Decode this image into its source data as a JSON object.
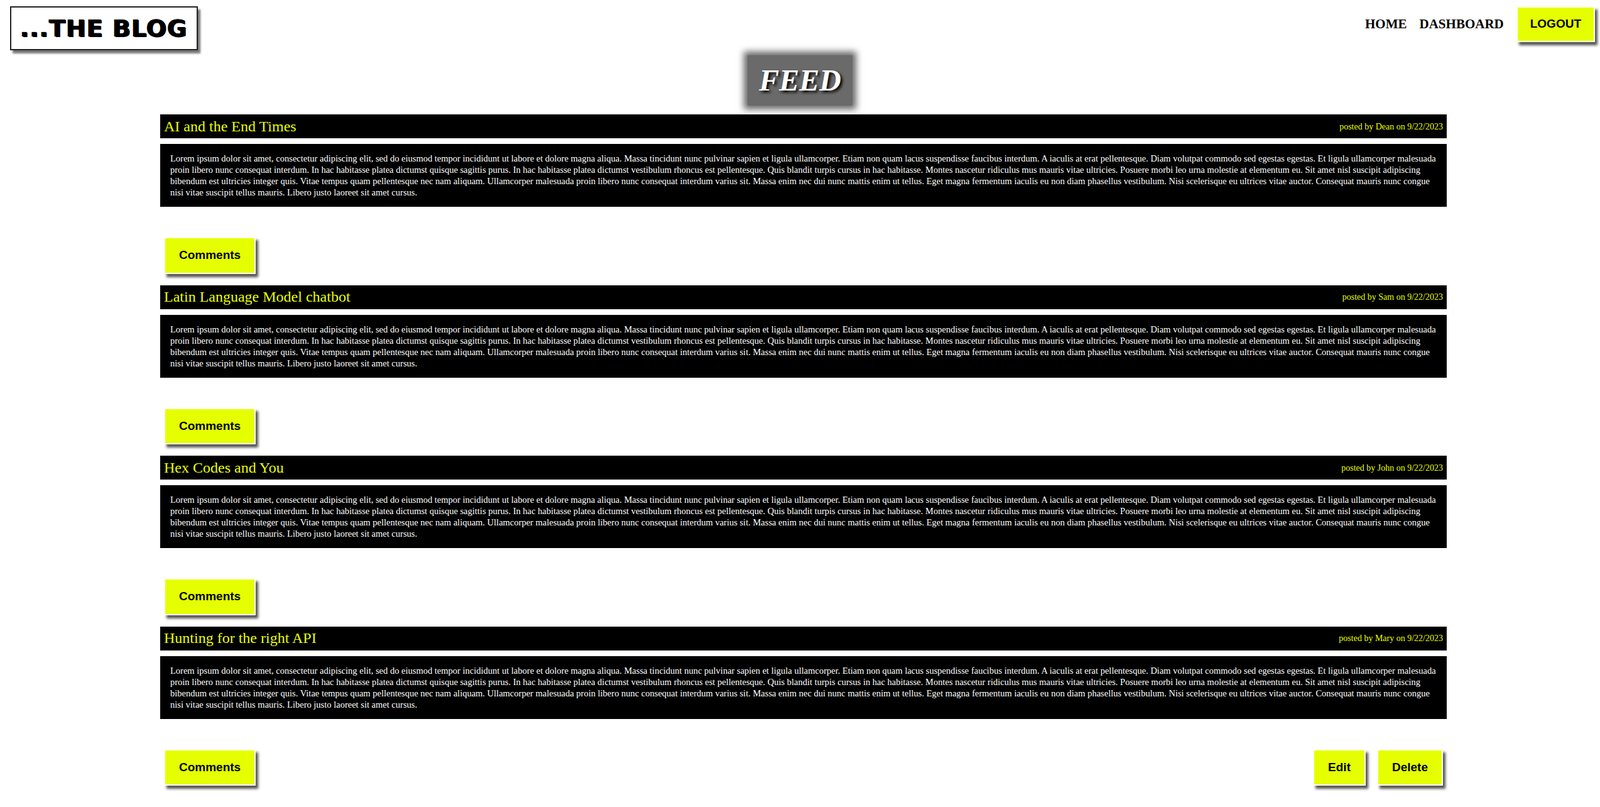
{
  "logo": "...THE BLOG",
  "nav": {
    "links": [
      "HOME",
      "DASHBOARD"
    ],
    "logout": "LOGOUT"
  },
  "page_title": "FEED",
  "posts": [
    {
      "title": "AI and the End Times",
      "meta": "posted by Dean on 9/22/2023",
      "body": "Lorem ipsum dolor sit amet, consectetur adipiscing elit, sed do eiusmod tempor incididunt ut labore et dolore magna aliqua. Massa tincidunt nunc pulvinar sapien et ligula ullamcorper. Etiam non quam lacus suspendisse faucibus interdum. A iaculis at erat pellentesque. Diam volutpat commodo sed egestas egestas. Et ligula ullamcorper malesuada proin libero nunc consequat interdum. In hac habitasse platea dictumst quisque sagittis purus. In hac habitasse platea dictumst vestibulum rhoncus est pellentesque. Quis blandit turpis cursus in hac habitasse. Montes nascetur ridiculus mus mauris vitae ultricies. Posuere morbi leo urna molestie at elementum eu. Sit amet nisl suscipit adipiscing bibendum est ultricies integer quis. Vitae tempus quam pellentesque nec nam aliquam. Ullamcorper malesuada proin libero nunc consequat interdum varius sit. Massa enim nec dui nunc mattis enim ut tellus. Eget magna fermentum iaculis eu non diam phasellus vestibulum. Nisi scelerisque eu ultrices vitae auctor. Consequat mauris nunc congue nisi vitae suscipit tellus mauris. Libero justo laoreet sit amet cursus.",
      "comments": "Comments",
      "actions": []
    },
    {
      "title": "Latin Language Model chatbot",
      "meta": "posted by Sam on 9/22/2023",
      "body": "Lorem ipsum dolor sit amet, consectetur adipiscing elit, sed do eiusmod tempor incididunt ut labore et dolore magna aliqua. Massa tincidunt nunc pulvinar sapien et ligula ullamcorper. Etiam non quam lacus suspendisse faucibus interdum. A iaculis at erat pellentesque. Diam volutpat commodo sed egestas egestas. Et ligula ullamcorper malesuada proin libero nunc consequat interdum. In hac habitasse platea dictumst quisque sagittis purus. In hac habitasse platea dictumst vestibulum rhoncus est pellentesque. Quis blandit turpis cursus in hac habitasse. Montes nascetur ridiculus mus mauris vitae ultricies. Posuere morbi leo urna molestie at elementum eu. Sit amet nisl suscipit adipiscing bibendum est ultricies integer quis. Vitae tempus quam pellentesque nec nam aliquam. Ullamcorper malesuada proin libero nunc consequat interdum varius sit. Massa enim nec dui nunc mattis enim ut tellus. Eget magna fermentum iaculis eu non diam phasellus vestibulum. Nisi scelerisque eu ultrices vitae auctor. Consequat mauris nunc congue nisi vitae suscipit tellus mauris. Libero justo laoreet sit amet cursus.",
      "comments": "Comments",
      "actions": []
    },
    {
      "title": "Hex Codes and You",
      "meta": "posted by John on 9/22/2023",
      "body": "Lorem ipsum dolor sit amet, consectetur adipiscing elit, sed do eiusmod tempor incididunt ut labore et dolore magna aliqua. Massa tincidunt nunc pulvinar sapien et ligula ullamcorper. Etiam non quam lacus suspendisse faucibus interdum. A iaculis at erat pellentesque. Diam volutpat commodo sed egestas egestas. Et ligula ullamcorper malesuada proin libero nunc consequat interdum. In hac habitasse platea dictumst quisque sagittis purus. In hac habitasse platea dictumst vestibulum rhoncus est pellentesque. Quis blandit turpis cursus in hac habitasse. Montes nascetur ridiculus mus mauris vitae ultricies. Posuere morbi leo urna molestie at elementum eu. Sit amet nisl suscipit adipiscing bibendum est ultricies integer quis. Vitae tempus quam pellentesque nec nam aliquam. Ullamcorper malesuada proin libero nunc consequat interdum varius sit. Massa enim nec dui nunc mattis enim ut tellus. Eget magna fermentum iaculis eu non diam phasellus vestibulum. Nisi scelerisque eu ultrices vitae auctor. Consequat mauris nunc congue nisi vitae suscipit tellus mauris. Libero justo laoreet sit amet cursus.",
      "comments": "Comments",
      "actions": []
    },
    {
      "title": "Hunting for the right API",
      "meta": "posted by Mary on 9/22/2023",
      "body": "Lorem ipsum dolor sit amet, consectetur adipiscing elit, sed do eiusmod tempor incididunt ut labore et dolore magna aliqua. Massa tincidunt nunc pulvinar sapien et ligula ullamcorper. Etiam non quam lacus suspendisse faucibus interdum. A iaculis at erat pellentesque. Diam volutpat commodo sed egestas egestas. Et ligula ullamcorper malesuada proin libero nunc consequat interdum. In hac habitasse platea dictumst quisque sagittis purus. In hac habitasse platea dictumst vestibulum rhoncus est pellentesque. Quis blandit turpis cursus in hac habitasse. Montes nascetur ridiculus mus mauris vitae ultricies. Posuere morbi leo urna molestie at elementum eu. Sit amet nisl suscipit adipiscing bibendum est ultricies integer quis. Vitae tempus quam pellentesque nec nam aliquam. Ullamcorper malesuada proin libero nunc consequat interdum varius sit. Massa enim nec dui nunc mattis enim ut tellus. Eget magna fermentum iaculis eu non diam phasellus vestibulum. Nisi scelerisque eu ultrices vitae auctor. Consequat mauris nunc congue nisi vitae suscipit tellus mauris. Libero justo laoreet sit amet cursus.",
      "comments": "Comments",
      "actions": [
        "Edit",
        "Delete"
      ]
    }
  ]
}
